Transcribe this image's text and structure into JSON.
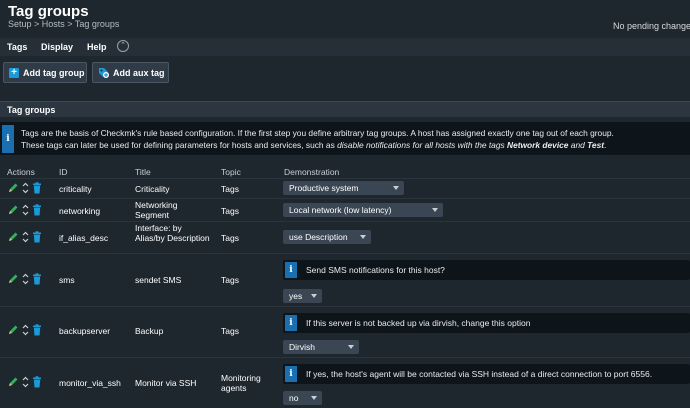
{
  "header": {
    "title": "Tag groups",
    "breadcrumb": "Setup > Hosts > Tag groups",
    "pending": "No pending change"
  },
  "menu": {
    "items": [
      "Tags",
      "Display",
      "Help"
    ],
    "collapse_icon": "chevron-up-icon"
  },
  "buttons": {
    "add_tag_group": "Add tag group",
    "add_aux_tag": "Add aux tag"
  },
  "section": {
    "title": "Tag groups"
  },
  "info": {
    "line1": "Tags are the basis of Checkmk's rule based configuration. If the first step you define arbitrary tag groups. A host has assigned exactly one tag out of each group.",
    "line2_plain": "These tags can later be used for defining parameters for hosts and services, such as ",
    "line2_italic": "disable notifications for all hosts with the tags ",
    "line2_bold1": "Network device",
    "line2_and": " and ",
    "line2_bold2": "Test",
    "line2_end": "."
  },
  "table": {
    "columns": [
      "Actions",
      "ID",
      "Title",
      "Topic",
      "Demonstration"
    ],
    "rows": [
      {
        "id": "criticality",
        "title": "Criticality",
        "topic": "Tags",
        "select": "Productive system",
        "help": ""
      },
      {
        "id": "networking",
        "title": "Networking Segment",
        "topic": "Tags",
        "select": "Local network (low latency)",
        "help": ""
      },
      {
        "id": "if_alias_desc",
        "title": "Interface: by Alias/by Description",
        "topic": "Tags",
        "select": "use Description",
        "help": ""
      },
      {
        "id": "sms",
        "title": "sendet SMS",
        "topic": "Tags",
        "select": "yes",
        "help": "Send SMS notifications for this host?"
      },
      {
        "id": "backupserver",
        "title": "Backup",
        "topic": "Tags",
        "select": "Dirvish",
        "help": "If this server is not backed up via dirvish, change this option"
      },
      {
        "id": "monitor_via_ssh",
        "title": "Monitor via SSH",
        "topic": "Monitoring agents",
        "select": "no",
        "help": "If yes, the host's agent will be contacted via SSH instead of a direct connection to port 6556."
      }
    ]
  },
  "colors": {
    "accent": "#1a9bd7",
    "info_badge": "#1a6fb0",
    "edit_icon": "#2fb35a",
    "delete_icon": "#1a9bd7",
    "background": "#1e262e"
  }
}
